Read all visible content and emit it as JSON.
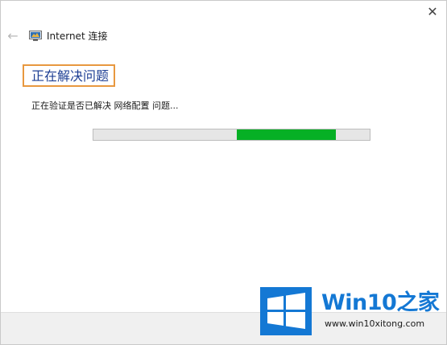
{
  "window": {
    "title": "Internet 连接",
    "close_glyph": "✕",
    "back_glyph": "←"
  },
  "page": {
    "heading": "正在解决问题",
    "status_text": "正在验证是否已解决 网络配置 问题..."
  },
  "progress": {
    "mode": "indeterminate",
    "fill_start_fraction": 0.52,
    "fill_end_fraction": 0.88,
    "fill_color": "#06b025",
    "track_color": "#e6e6e6"
  },
  "colors": {
    "heading": "#1e3f94",
    "highlight_border": "#e8983f",
    "brand_blue": "#1478d4"
  },
  "icons": {
    "back": "back-arrow-icon",
    "close": "close-icon",
    "app": "network-connection-icon",
    "watermark_logo": "windows-logo-icon"
  },
  "watermark": {
    "brand": "Win10之家",
    "url": "www.win10xitong.com"
  }
}
